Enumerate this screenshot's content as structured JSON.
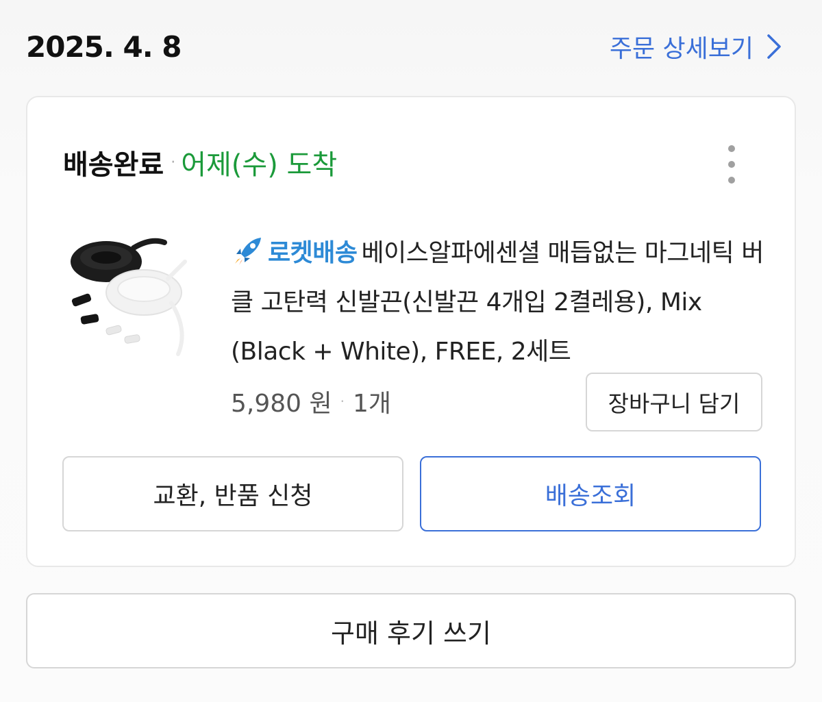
{
  "order": {
    "date": "2025. 4. 8",
    "detail_link_label": "주문 상세보기"
  },
  "card": {
    "status": "배송완료",
    "arrival": "어제(수) 도착",
    "product": {
      "badge": "로켓배송",
      "name": "베이스알파에센셜 매듭없는 마그네틱 버클 고탄력 신발끈(신발끈 4개입 2켤레용), Mix (Black + White), FREE, 2세트",
      "price": "5,980 원",
      "quantity": "1개"
    },
    "cart_button": "장바구니 담기",
    "return_button": "교환, 반품 신청",
    "track_button": "배송조회"
  },
  "review_button": "구매 후기 쓰기",
  "colors": {
    "accent_blue": "#3a6fd8",
    "arrival_green": "#1b9a3a",
    "rocket_blue": "#2d8ad6"
  },
  "icons": {
    "detail_chevron": "chevron-right-icon",
    "more": "more-vertical-icon",
    "rocket": "rocket-icon"
  }
}
